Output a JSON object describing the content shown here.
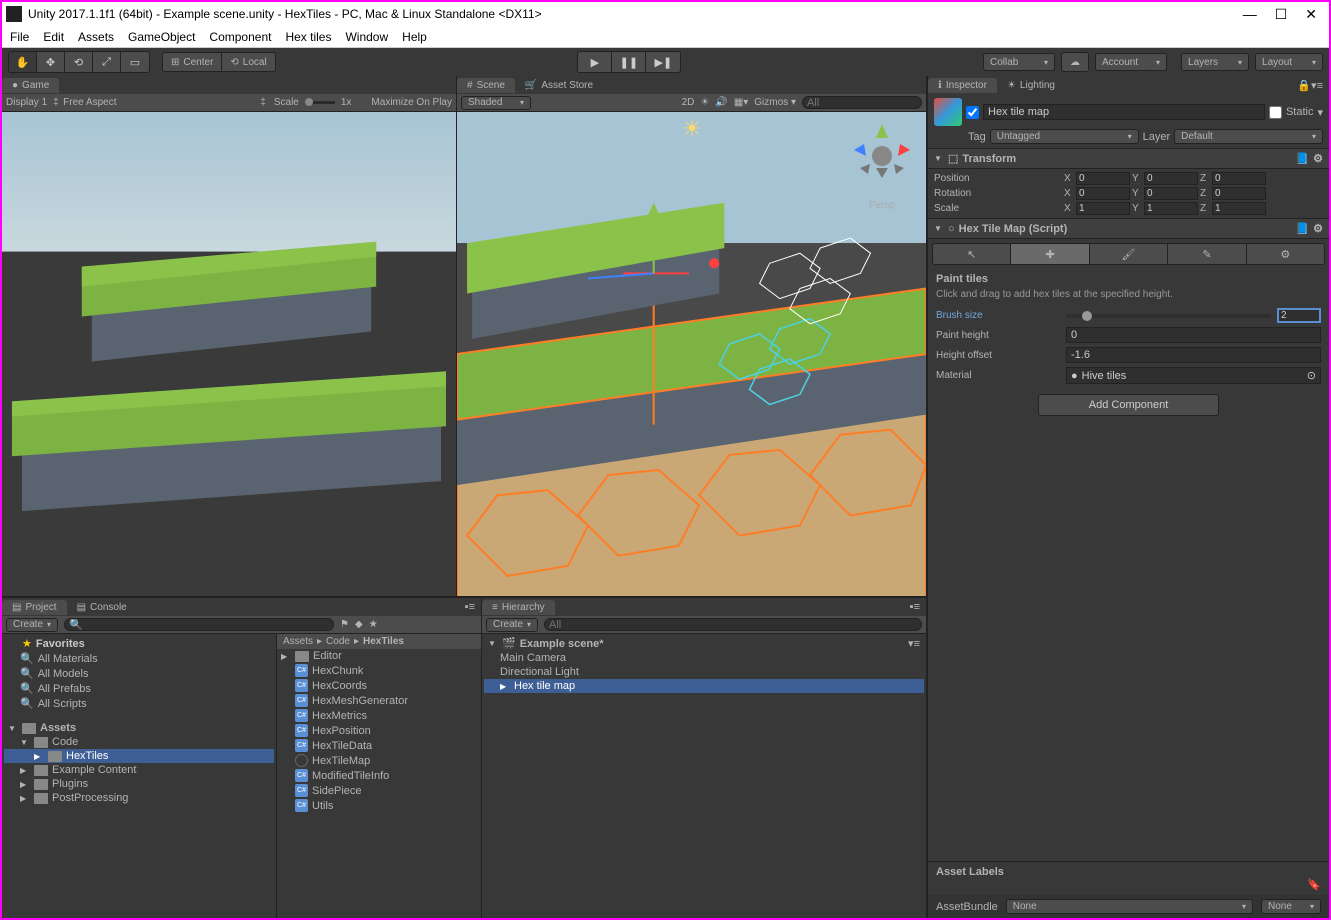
{
  "title": "Unity 2017.1.1f1 (64bit) - Example scene.unity - HexTiles - PC, Mac & Linux Standalone <DX11>",
  "menu": [
    "File",
    "Edit",
    "Assets",
    "GameObject",
    "Component",
    "Hex tiles",
    "Window",
    "Help"
  ],
  "toolbar": {
    "center": "Center",
    "local": "Local",
    "collab": "Collab",
    "account": "Account",
    "layers": "Layers",
    "layout": "Layout"
  },
  "game": {
    "tab": "Game",
    "display": "Display 1",
    "aspect": "Free Aspect",
    "scale": "Scale",
    "scale_val": "1x",
    "maximize": "Maximize On Play"
  },
  "scene": {
    "tab": "Scene",
    "asset_store_tab": "Asset Store",
    "shading": "Shaded",
    "twod": "2D",
    "gizmos": "Gizmos",
    "search_placeholder": "All",
    "persp": "Persp"
  },
  "project": {
    "tab": "Project",
    "console_tab": "Console",
    "create": "Create",
    "favorites": "Favorites",
    "favs": [
      "All Materials",
      "All Models",
      "All Prefabs",
      "All Scripts"
    ],
    "assets": "Assets",
    "folders": [
      {
        "name": "Code",
        "children": [
          "HexTiles"
        ]
      },
      {
        "name": "Example Content"
      },
      {
        "name": "Plugins"
      },
      {
        "name": "PostProcessing"
      }
    ],
    "breadcrumb": [
      "Assets",
      "Code",
      "HexTiles"
    ],
    "files": [
      "Editor",
      "HexChunk",
      "HexCoords",
      "HexMeshGenerator",
      "HexMetrics",
      "HexPosition",
      "HexTileData",
      "HexTileMap",
      "ModifiedTileInfo",
      "SidePiece",
      "Utils"
    ]
  },
  "hierarchy": {
    "tab": "Hierarchy",
    "create": "Create",
    "search_placeholder": "All",
    "scene_name": "Example scene*",
    "items": [
      "Main Camera",
      "Directional Light",
      "Hex tile map"
    ]
  },
  "inspector": {
    "tab": "Inspector",
    "lighting_tab": "Lighting",
    "go_name": "Hex tile map",
    "static": "Static",
    "tag": "Tag",
    "tag_val": "Untagged",
    "layer": "Layer",
    "layer_val": "Default",
    "transform": {
      "title": "Transform",
      "position": "Position",
      "rotation": "Rotation",
      "scale": "Scale",
      "pos": {
        "x": "0",
        "y": "0",
        "z": "0"
      },
      "rot": {
        "x": "0",
        "y": "0",
        "z": "0"
      },
      "scl": {
        "x": "1",
        "y": "1",
        "z": "1"
      }
    },
    "hex": {
      "title": "Hex Tile Map (Script)",
      "section": "Paint tiles",
      "help": "Click and drag to add hex tiles at the specified height.",
      "brush_size": "Brush size",
      "brush_val": "2",
      "paint_height": "Paint height",
      "paint_val": "0",
      "height_offset": "Height offset",
      "height_val": "-1.6",
      "material": "Material",
      "material_val": "Hive tiles"
    },
    "add_component": "Add Component",
    "asset_labels": "Asset Labels",
    "assetbundle": "AssetBundle",
    "none": "None"
  }
}
